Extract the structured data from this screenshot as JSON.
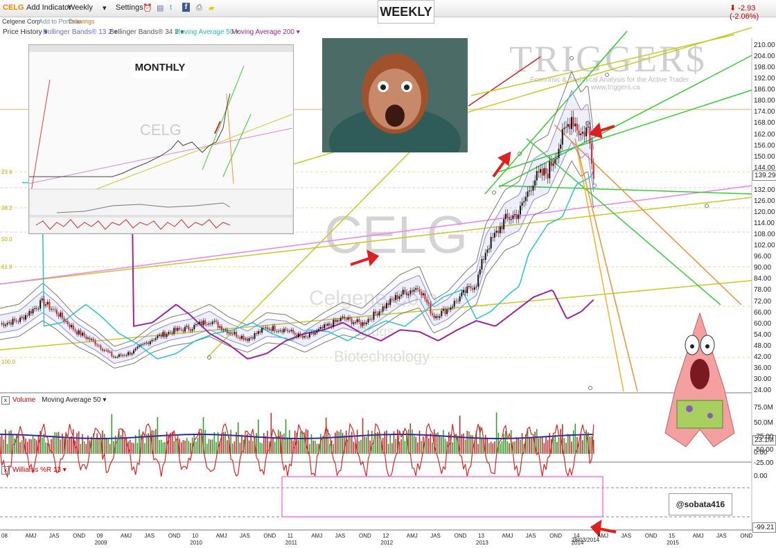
{
  "toolbar": {
    "symbol": "CELG",
    "add_indicator": "Add Indicator",
    "period": "Weekly",
    "settings": "Settings",
    "change": "-2.93 (-2.06%)"
  },
  "subbar": {
    "company": "Celgene Corp",
    "add_portfolio": "Add to Portfolio",
    "drawings": "Drawings"
  },
  "legend": [
    {
      "label": "Price History ▾",
      "color": "#333333"
    },
    {
      "label": "Bollinger Bands® 13 2 ▾",
      "color": "#6a6ae0"
    },
    {
      "label": "Bollinger Bands® 34 2 ▾",
      "color": "#555555"
    },
    {
      "label": "Moving Average 50 ▾",
      "color": "#22b9c9"
    },
    {
      "label": "Moving Average 200 ▾",
      "color": "#a020a0"
    }
  ],
  "labels": {
    "weekly": "WEEKLY",
    "monthly": "MONTHLY",
    "watermark_ticker": "CELG",
    "watermark_company": "Celgene Corp",
    "watermark_sector": "Drugs",
    "watermark_industry": "Biotechnology",
    "brand": "TRIGGER$",
    "brand_tagline": "Economic & Technical Analysis for the Active Trader",
    "brand_url": "www.triggers.ca",
    "author": "@sobata416",
    "date_marker": "28/03/2014"
  },
  "fib_labels": [
    "23.6",
    "38.2",
    "50.0",
    "61.8",
    "100.0"
  ],
  "panels": {
    "volume_title": "Volume",
    "volume_ma": "Moving Average 50 ▾",
    "williams_title": "Williams %R 13 ▾"
  },
  "price_axis": [
    "210.00",
    "204.00",
    "198.00",
    "192.00",
    "186.00",
    "180.00",
    "174.00",
    "168.00",
    "162.00",
    "156.00",
    "150.00",
    "144.00",
    "138.00",
    "132.00",
    "126.00",
    "120.00",
    "114.00",
    "108.00",
    "102.00",
    "96.00",
    "90.00",
    "84.00",
    "78.00",
    "72.00",
    "66.00",
    "60.00",
    "54.00",
    "48.00",
    "42.00",
    "36.00",
    "30.00",
    "24.00"
  ],
  "volume_axis": [
    "75.0M",
    "50.0M",
    "0.00"
  ],
  "williams_axis": [
    "0.00",
    "-25.00",
    "-50.00",
    "-75.00"
  ],
  "x_axis": [
    {
      "m": "08",
      "y": ""
    },
    {
      "m": "AMJ",
      "y": ""
    },
    {
      "m": "JAS",
      "y": ""
    },
    {
      "m": "OND",
      "y": ""
    },
    {
      "m": "09",
      "y": "2009"
    },
    {
      "m": "AMJ",
      "y": ""
    },
    {
      "m": "JAS",
      "y": ""
    },
    {
      "m": "OND",
      "y": ""
    },
    {
      "m": "10",
      "y": "2010"
    },
    {
      "m": "AMJ",
      "y": ""
    },
    {
      "m": "JAS",
      "y": ""
    },
    {
      "m": "OND",
      "y": ""
    },
    {
      "m": "11",
      "y": "2011"
    },
    {
      "m": "AMJ",
      "y": ""
    },
    {
      "m": "JAS",
      "y": ""
    },
    {
      "m": "OND",
      "y": ""
    },
    {
      "m": "12",
      "y": "2012"
    },
    {
      "m": "AMJ",
      "y": ""
    },
    {
      "m": "JAS",
      "y": ""
    },
    {
      "m": "OND",
      "y": ""
    },
    {
      "m": "13",
      "y": "2013"
    },
    {
      "m": "AMJ",
      "y": ""
    },
    {
      "m": "JAS",
      "y": ""
    },
    {
      "m": "OND",
      "y": ""
    },
    {
      "m": "14",
      "y": "2014"
    },
    {
      "m": "AMJ",
      "y": ""
    },
    {
      "m": "JAS",
      "y": ""
    },
    {
      "m": "OND",
      "y": ""
    },
    {
      "m": "15",
      "y": "2015"
    },
    {
      "m": "AMJ",
      "y": ""
    },
    {
      "m": "JAS",
      "y": ""
    },
    {
      "m": "OND",
      "y": ""
    }
  ],
  "chart_data": {
    "type": "line",
    "title": "CELG",
    "period": "Weekly",
    "price_range": [
      24,
      210
    ],
    "last_price": "139.29",
    "last_volume": "23.1M",
    "last_williams": "-99.21",
    "price_anchors": [
      {
        "t": 2008.0,
        "v": 60
      },
      {
        "t": 2008.2,
        "v": 62
      },
      {
        "t": 2008.45,
        "v": 72
      },
      {
        "t": 2008.6,
        "v": 66
      },
      {
        "t": 2008.8,
        "v": 56
      },
      {
        "t": 2009.0,
        "v": 50
      },
      {
        "t": 2009.2,
        "v": 42
      },
      {
        "t": 2009.4,
        "v": 45
      },
      {
        "t": 2009.6,
        "v": 52
      },
      {
        "t": 2009.8,
        "v": 56
      },
      {
        "t": 2010.0,
        "v": 58
      },
      {
        "t": 2010.2,
        "v": 62
      },
      {
        "t": 2010.4,
        "v": 56
      },
      {
        "t": 2010.6,
        "v": 52
      },
      {
        "t": 2010.8,
        "v": 58
      },
      {
        "t": 2011.0,
        "v": 57
      },
      {
        "t": 2011.2,
        "v": 52
      },
      {
        "t": 2011.4,
        "v": 58
      },
      {
        "t": 2011.6,
        "v": 63
      },
      {
        "t": 2011.8,
        "v": 60
      },
      {
        "t": 2012.0,
        "v": 68
      },
      {
        "t": 2012.2,
        "v": 76
      },
      {
        "t": 2012.4,
        "v": 80
      },
      {
        "t": 2012.55,
        "v": 64
      },
      {
        "t": 2012.7,
        "v": 68
      },
      {
        "t": 2012.9,
        "v": 78
      },
      {
        "t": 2013.0,
        "v": 82
      },
      {
        "t": 2013.1,
        "v": 100
      },
      {
        "t": 2013.3,
        "v": 116
      },
      {
        "t": 2013.45,
        "v": 120
      },
      {
        "t": 2013.6,
        "v": 138
      },
      {
        "t": 2013.75,
        "v": 142
      },
      {
        "t": 2013.9,
        "v": 160
      },
      {
        "t": 2014.0,
        "v": 172
      },
      {
        "t": 2014.1,
        "v": 162
      },
      {
        "t": 2014.17,
        "v": 166
      },
      {
        "t": 2014.24,
        "v": 139
      }
    ],
    "volume": {
      "max_label": "75.0M",
      "ma50": 23.1
    },
    "williams_r": {
      "period": 13,
      "levels": [
        0,
        -25,
        -50,
        -75
      ],
      "last": -99.21
    }
  }
}
